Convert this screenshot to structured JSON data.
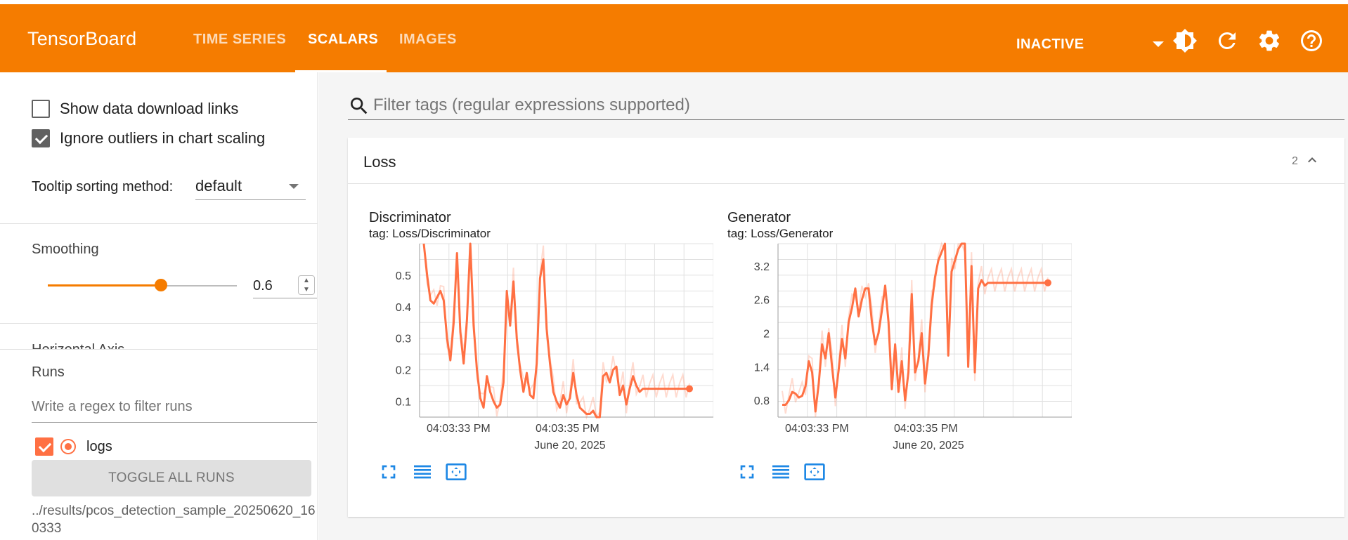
{
  "app": {
    "title": "TensorBoard"
  },
  "nav": {
    "tabs": [
      {
        "label": "TIME SERIES",
        "active": false
      },
      {
        "label": "SCALARS",
        "active": true
      },
      {
        "label": "IMAGES",
        "active": false
      }
    ]
  },
  "toolbar": {
    "dropdown_value": "INACTIVE",
    "icons": [
      "brightness-icon",
      "refresh-icon",
      "settings-icon",
      "help-icon"
    ]
  },
  "colors": {
    "appbar": "#f57c00",
    "series": "#ff7043"
  },
  "sidebar": {
    "show_download_links": "Show data download links",
    "ignore_outliers": "Ignore outliers in chart scaling",
    "tooltip_label": "Tooltip sorting method:",
    "tooltip_value": "default",
    "smoothing_label": "Smoothing",
    "smoothing_value": "0.6",
    "horizontal_axis_label": "Horizontal Axis",
    "runs_title": "Runs",
    "runs_filter_placeholder": "Write a regex to filter runs",
    "run_name": "logs",
    "toggle_all": "TOGGLE ALL RUNS",
    "run_path": "../results/pcos_detection_sample_20250620_160333"
  },
  "main": {
    "filter_placeholder": "Filter tags (regular expressions supported)",
    "card": {
      "title": "Loss",
      "count": "2"
    }
  },
  "chart_data": [
    {
      "type": "line",
      "title": "Discriminator",
      "tag": "tag: Loss/Discriminator",
      "date_label": "June 20, 2025",
      "x_tick_labels": [
        "04:03:33 PM",
        "04:03:35 PM"
      ],
      "y_tick_labels": [
        "0.1",
        "0.2",
        "0.3",
        "0.4",
        "0.5"
      ],
      "ylim": [
        0.05,
        0.6
      ],
      "x": [
        0,
        0.5,
        1,
        1.5,
        2,
        2.5,
        3,
        3.5,
        4,
        4.5,
        5,
        5.5,
        6,
        6.5,
        7,
        7.5,
        8,
        8.5,
        9,
        9.5,
        10,
        10.5,
        11,
        11.5,
        12,
        12.5,
        13,
        13.5,
        14,
        14.5,
        15,
        15.5,
        16,
        16.5,
        17,
        17.5,
        18,
        18.5,
        19,
        19.5,
        20,
        20.5,
        21,
        21.5,
        22,
        22.5,
        23,
        23.5,
        24,
        24.5,
        25,
        25.5,
        26,
        26.5,
        27,
        27.5,
        28,
        28.5,
        29,
        29.5,
        30,
        30.5,
        31,
        31.5,
        32,
        32.5,
        33,
        33.5,
        34,
        34.5,
        35,
        35.5,
        36,
        36.5,
        37,
        37.5,
        38,
        38.5,
        39,
        39.5,
        40
      ],
      "series": [
        {
          "values": [
            0.6,
            0.5,
            0.42,
            0.41,
            0.43,
            0.45,
            0.42,
            0.3,
            0.23,
            0.35,
            0.57,
            0.32,
            0.22,
            0.36,
            0.6,
            0.34,
            0.2,
            0.11,
            0.08,
            0.18,
            0.13,
            0.1,
            0.08,
            0.09,
            0.16,
            0.45,
            0.34,
            0.48,
            0.3,
            0.2,
            0.13,
            0.19,
            0.12,
            0.11,
            0.22,
            0.49,
            0.55,
            0.33,
            0.22,
            0.13,
            0.1,
            0.08,
            0.12,
            0.09,
            0.11,
            0.19,
            0.12,
            0.08,
            0.07,
            0.06,
            0.06,
            0.07,
            0.05,
            0.05,
            0.18,
            0.19,
            0.16,
            0.2,
            0.21,
            0.12,
            0.15,
            0.09,
            0.14,
            0.18,
            0.15,
            0.13,
            0.14,
            0.14,
            0.14,
            0.14,
            0.14,
            0.14,
            0.14,
            0.14,
            0.14,
            0.14,
            0.14,
            0.14,
            0.14,
            0.14,
            0.14
          ]
        }
      ]
    },
    {
      "type": "line",
      "title": "Generator",
      "tag": "tag: Loss/Generator",
      "date_label": "June 20, 2025",
      "x_tick_labels": [
        "04:03:33 PM",
        "04:03:35 PM"
      ],
      "y_tick_labels": [
        "0.8",
        "1.4",
        "2",
        "2.6",
        "3.2"
      ],
      "ylim": [
        0.5,
        3.6
      ],
      "x": [
        0,
        0.5,
        1,
        1.5,
        2,
        2.5,
        3,
        3.5,
        4,
        4.5,
        5,
        5.5,
        6,
        6.5,
        7,
        7.5,
        8,
        8.5,
        9,
        9.5,
        10,
        10.5,
        11,
        11.5,
        12,
        12.5,
        13,
        13.5,
        14,
        14.5,
        15,
        15.5,
        16,
        16.5,
        17,
        17.5,
        18,
        18.5,
        19,
        19.5,
        20,
        20.5,
        21,
        21.5,
        22,
        22.5,
        23,
        23.5,
        24,
        24.5,
        25,
        25.5,
        26,
        26.5,
        27,
        27.5,
        28,
        28.5,
        29,
        29.5,
        30,
        30.5,
        31,
        31.5,
        32,
        32.5,
        33,
        33.5,
        34,
        34.5,
        35,
        35.5,
        36,
        36.5,
        37,
        37.5,
        38,
        38.5,
        39,
        39.5,
        40
      ],
      "series": [
        {
          "values": [
            0.72,
            0.72,
            0.8,
            0.95,
            0.92,
            0.85,
            0.88,
            1.05,
            1.5,
            1.3,
            0.6,
            1.1,
            1.8,
            1.55,
            2.0,
            1.4,
            0.85,
            1.35,
            1.9,
            1.55,
            2.2,
            2.45,
            2.8,
            2.3,
            2.6,
            2.8,
            2.8,
            2.2,
            1.8,
            2.0,
            2.4,
            2.85,
            2.2,
            1.0,
            1.8,
            0.95,
            1.5,
            0.8,
            1.3,
            2.7,
            1.3,
            1.5,
            2.0,
            1.1,
            1.6,
            2.5,
            3.0,
            3.3,
            3.45,
            3.6,
            1.6,
            3.1,
            3.3,
            3.5,
            3.6,
            3.6,
            1.4,
            3.2,
            1.3,
            2.8,
            2.95,
            2.85,
            2.9,
            2.9,
            2.9,
            2.9,
            2.9,
            2.9,
            2.9,
            2.9,
            2.9,
            2.9,
            2.9,
            2.9,
            2.9,
            2.9,
            2.9,
            2.9,
            2.9,
            2.9,
            2.9
          ]
        }
      ]
    }
  ]
}
